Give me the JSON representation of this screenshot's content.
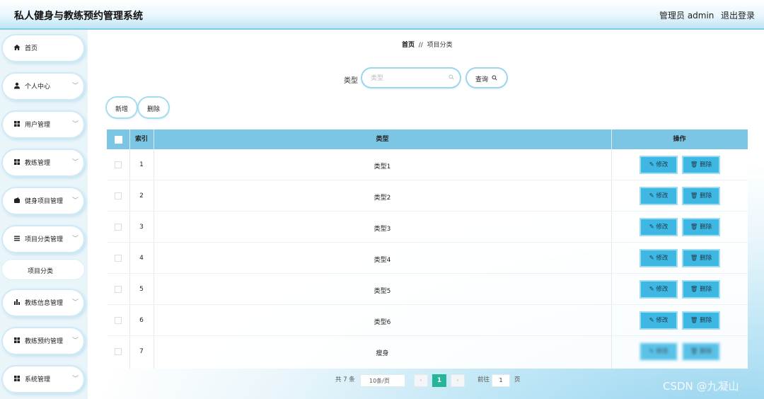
{
  "header": {
    "title": "私人健身与教练预约管理系统",
    "admin": "管理员 admin",
    "logout": "退出登录"
  },
  "sidebar": {
    "items": [
      {
        "label": "首页",
        "icon": "home-icon"
      },
      {
        "label": "个人中心",
        "icon": "user-icon"
      },
      {
        "label": "用户管理",
        "icon": "grid-icon"
      },
      {
        "label": "教练管理",
        "icon": "grid-icon"
      },
      {
        "label": "健身项目管理",
        "icon": "wallet-icon"
      },
      {
        "label": "项目分类管理",
        "icon": "list-icon"
      },
      {
        "label": "教练信息管理",
        "icon": "bar-chart-icon"
      },
      {
        "label": "教练预约管理",
        "icon": "grid-icon"
      },
      {
        "label": "系统管理",
        "icon": "grid-icon"
      }
    ],
    "sub_item": "项目分类"
  },
  "breadcrumb": {
    "home": "首页",
    "sep": "//",
    "current": "项目分类"
  },
  "search": {
    "label": "类型",
    "placeholder": "类型",
    "button": "查询"
  },
  "actions": {
    "add": "新增",
    "delete": "删除"
  },
  "table": {
    "columns": [
      "索引",
      "类型",
      "操作"
    ],
    "rows": [
      {
        "index": "1",
        "type": "类型1"
      },
      {
        "index": "2",
        "type": "类型2"
      },
      {
        "index": "3",
        "type": "类型3"
      },
      {
        "index": "4",
        "type": "类型4"
      },
      {
        "index": "5",
        "type": "类型5"
      },
      {
        "index": "6",
        "type": "类型6"
      },
      {
        "index": "7",
        "type": "瘦身"
      }
    ],
    "edit_label": "修改",
    "delete_label": "删除"
  },
  "pagination": {
    "total": "共 7 条",
    "page_size": "10条/页",
    "current": "1",
    "goto_label": "前往",
    "goto_value": "1",
    "page_unit": "页"
  },
  "watermark": "CSDN @九凝山",
  "colors": {
    "header_accent": "#7ecbea",
    "table_head": "#7cc6e5",
    "op_button": "#3fb7e3",
    "pager_active": "#26b597"
  }
}
